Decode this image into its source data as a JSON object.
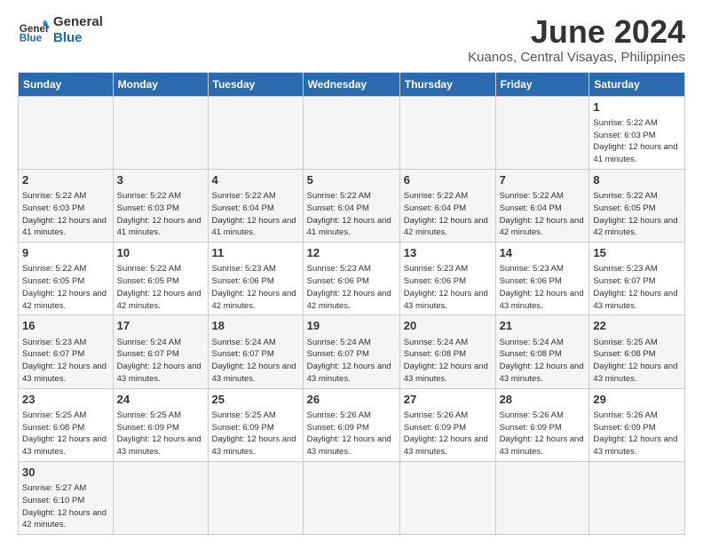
{
  "header": {
    "logo_general": "General",
    "logo_blue": "Blue",
    "title": "June 2024",
    "subtitle": "Kuanos, Central Visayas, Philippines"
  },
  "weekdays": [
    "Sunday",
    "Monday",
    "Tuesday",
    "Wednesday",
    "Thursday",
    "Friday",
    "Saturday"
  ],
  "weeks": [
    [
      {
        "day": "",
        "text": ""
      },
      {
        "day": "",
        "text": ""
      },
      {
        "day": "",
        "text": ""
      },
      {
        "day": "",
        "text": ""
      },
      {
        "day": "",
        "text": ""
      },
      {
        "day": "",
        "text": ""
      },
      {
        "day": "1",
        "text": "Sunrise: 5:22 AM\nSunset: 6:03 PM\nDaylight: 12 hours and 41 minutes."
      }
    ],
    [
      {
        "day": "2",
        "text": "Sunrise: 5:22 AM\nSunset: 6:03 PM\nDaylight: 12 hours and 41 minutes."
      },
      {
        "day": "3",
        "text": "Sunrise: 5:22 AM\nSunset: 6:03 PM\nDaylight: 12 hours and 41 minutes."
      },
      {
        "day": "4",
        "text": "Sunrise: 5:22 AM\nSunset: 6:04 PM\nDaylight: 12 hours and 41 minutes."
      },
      {
        "day": "5",
        "text": "Sunrise: 5:22 AM\nSunset: 6:04 PM\nDaylight: 12 hours and 41 minutes."
      },
      {
        "day": "6",
        "text": "Sunrise: 5:22 AM\nSunset: 6:04 PM\nDaylight: 12 hours and 42 minutes."
      },
      {
        "day": "7",
        "text": "Sunrise: 5:22 AM\nSunset: 6:04 PM\nDaylight: 12 hours and 42 minutes."
      },
      {
        "day": "8",
        "text": "Sunrise: 5:22 AM\nSunset: 6:05 PM\nDaylight: 12 hours and 42 minutes."
      }
    ],
    [
      {
        "day": "9",
        "text": "Sunrise: 5:22 AM\nSunset: 6:05 PM\nDaylight: 12 hours and 42 minutes."
      },
      {
        "day": "10",
        "text": "Sunrise: 5:22 AM\nSunset: 6:05 PM\nDaylight: 12 hours and 42 minutes."
      },
      {
        "day": "11",
        "text": "Sunrise: 5:23 AM\nSunset: 6:06 PM\nDaylight: 12 hours and 42 minutes."
      },
      {
        "day": "12",
        "text": "Sunrise: 5:23 AM\nSunset: 6:06 PM\nDaylight: 12 hours and 42 minutes."
      },
      {
        "day": "13",
        "text": "Sunrise: 5:23 AM\nSunset: 6:06 PM\nDaylight: 12 hours and 43 minutes."
      },
      {
        "day": "14",
        "text": "Sunrise: 5:23 AM\nSunset: 6:06 PM\nDaylight: 12 hours and 43 minutes."
      },
      {
        "day": "15",
        "text": "Sunrise: 5:23 AM\nSunset: 6:07 PM\nDaylight: 12 hours and 43 minutes."
      }
    ],
    [
      {
        "day": "16",
        "text": "Sunrise: 5:23 AM\nSunset: 6:07 PM\nDaylight: 12 hours and 43 minutes."
      },
      {
        "day": "17",
        "text": "Sunrise: 5:24 AM\nSunset: 6:07 PM\nDaylight: 12 hours and 43 minutes."
      },
      {
        "day": "18",
        "text": "Sunrise: 5:24 AM\nSunset: 6:07 PM\nDaylight: 12 hours and 43 minutes."
      },
      {
        "day": "19",
        "text": "Sunrise: 5:24 AM\nSunset: 6:07 PM\nDaylight: 12 hours and 43 minutes."
      },
      {
        "day": "20",
        "text": "Sunrise: 5:24 AM\nSunset: 6:08 PM\nDaylight: 12 hours and 43 minutes."
      },
      {
        "day": "21",
        "text": "Sunrise: 5:24 AM\nSunset: 6:08 PM\nDaylight: 12 hours and 43 minutes."
      },
      {
        "day": "22",
        "text": "Sunrise: 5:25 AM\nSunset: 6:08 PM\nDaylight: 12 hours and 43 minutes."
      }
    ],
    [
      {
        "day": "23",
        "text": "Sunrise: 5:25 AM\nSunset: 6:08 PM\nDaylight: 12 hours and 43 minutes."
      },
      {
        "day": "24",
        "text": "Sunrise: 5:25 AM\nSunset: 6:09 PM\nDaylight: 12 hours and 43 minutes."
      },
      {
        "day": "25",
        "text": "Sunrise: 5:25 AM\nSunset: 6:09 PM\nDaylight: 12 hours and 43 minutes."
      },
      {
        "day": "26",
        "text": "Sunrise: 5:26 AM\nSunset: 6:09 PM\nDaylight: 12 hours and 43 minutes."
      },
      {
        "day": "27",
        "text": "Sunrise: 5:26 AM\nSunset: 6:09 PM\nDaylight: 12 hours and 43 minutes."
      },
      {
        "day": "28",
        "text": "Sunrise: 5:26 AM\nSunset: 6:09 PM\nDaylight: 12 hours and 43 minutes."
      },
      {
        "day": "29",
        "text": "Sunrise: 5:26 AM\nSunset: 6:09 PM\nDaylight: 12 hours and 43 minutes."
      }
    ],
    [
      {
        "day": "30",
        "text": "Sunrise: 5:27 AM\nSunset: 6:10 PM\nDaylight: 12 hours and 42 minutes."
      },
      {
        "day": "",
        "text": ""
      },
      {
        "day": "",
        "text": ""
      },
      {
        "day": "",
        "text": ""
      },
      {
        "day": "",
        "text": ""
      },
      {
        "day": "",
        "text": ""
      },
      {
        "day": "",
        "text": ""
      }
    ]
  ]
}
